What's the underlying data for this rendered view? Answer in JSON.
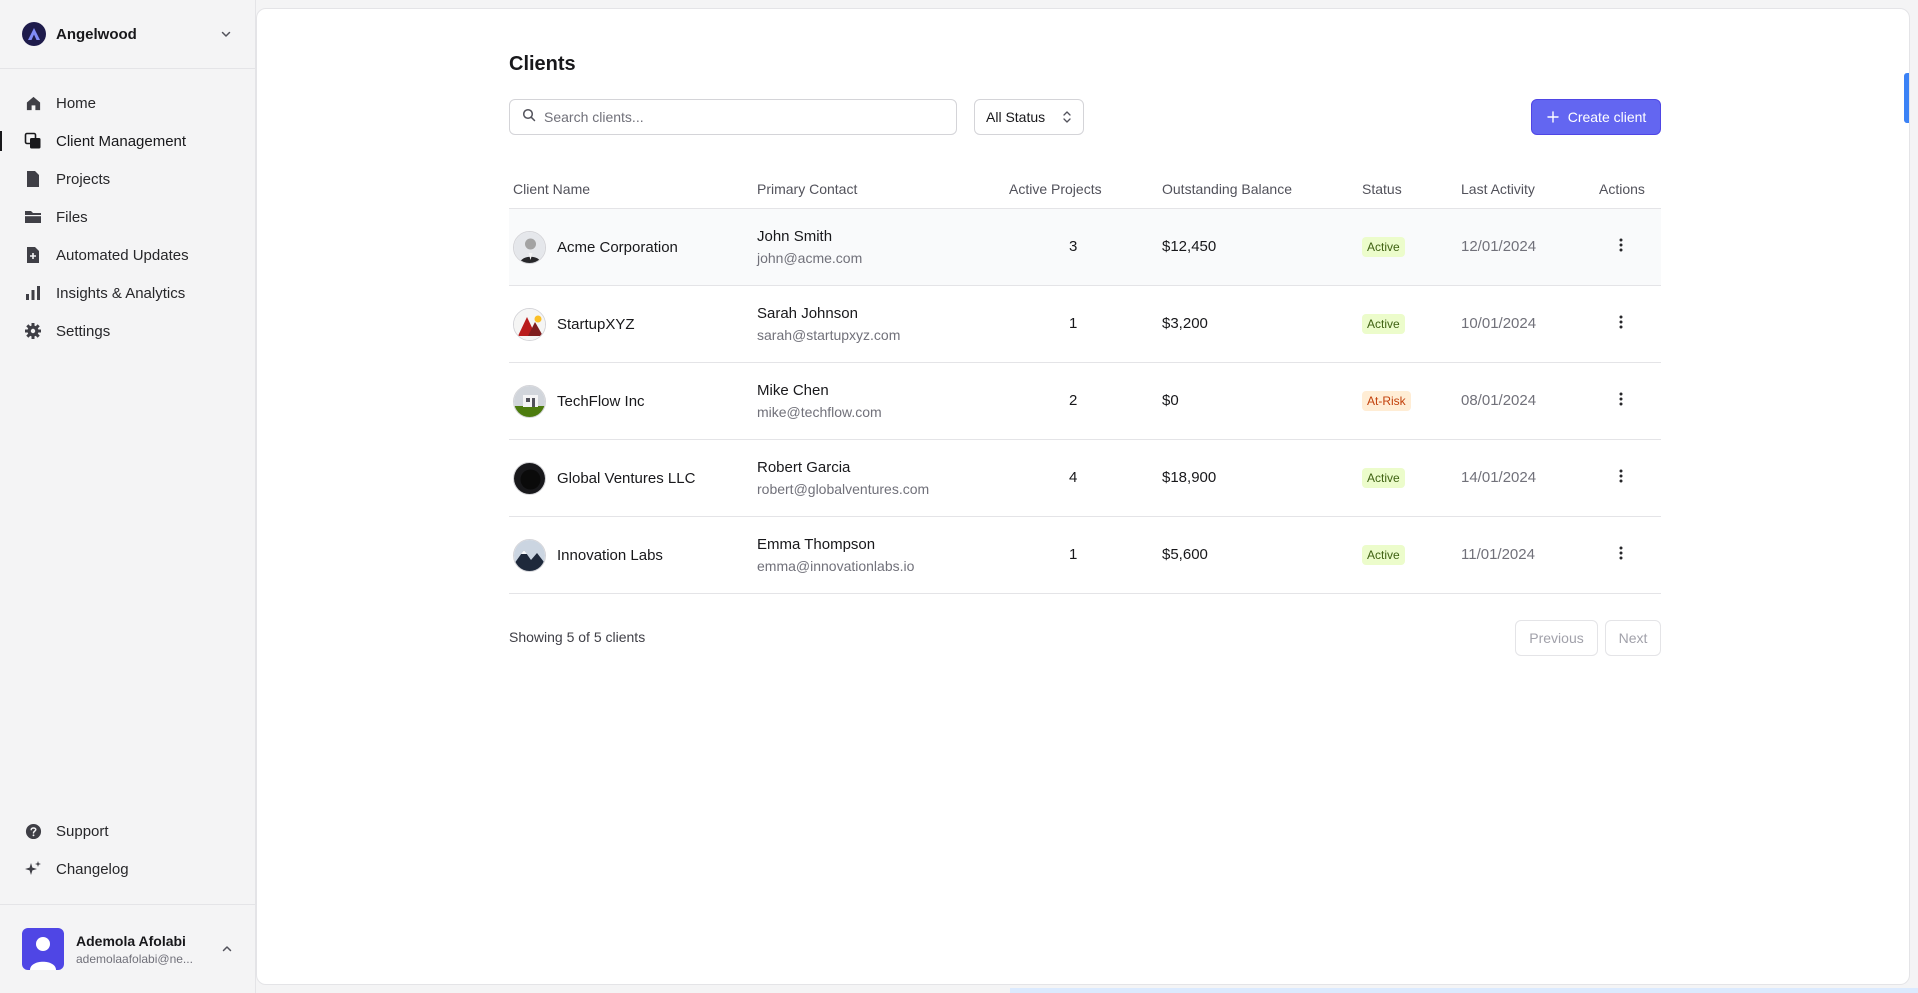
{
  "workspace": {
    "name": "Angelwood"
  },
  "nav": {
    "items": [
      {
        "label": "Home",
        "icon": "home-icon"
      },
      {
        "label": "Client Management",
        "icon": "stack-icon",
        "active": true
      },
      {
        "label": "Projects",
        "icon": "document-icon"
      },
      {
        "label": "Files",
        "icon": "folder-icon"
      },
      {
        "label": "Automated Updates",
        "icon": "file-plus-icon"
      },
      {
        "label": "Insights & Analytics",
        "icon": "bar-chart-icon"
      },
      {
        "label": "Settings",
        "icon": "gear-icon"
      }
    ],
    "bottom": [
      {
        "label": "Support",
        "icon": "help-circle-icon"
      },
      {
        "label": "Changelog",
        "icon": "sparkles-icon"
      }
    ]
  },
  "user": {
    "name": "Ademola Afolabi",
    "email": "ademolaafolabi@ne..."
  },
  "page": {
    "title": "Clients",
    "search_placeholder": "Search clients...",
    "status_filter": "All Status",
    "create_label": "Create client"
  },
  "table": {
    "headers": {
      "client": "Client Name",
      "contact": "Primary Contact",
      "projects": "Active Projects",
      "balance": "Outstanding Balance",
      "status": "Status",
      "activity": "Last Activity",
      "actions": "Actions"
    },
    "rows": [
      {
        "client": "Acme Corporation",
        "contact_name": "John Smith",
        "contact_email": "john@acme.com",
        "projects": "3",
        "balance": "$12,450",
        "status": "Active",
        "activity": "12/01/2024"
      },
      {
        "client": "StartupXYZ",
        "contact_name": "Sarah Johnson",
        "contact_email": "sarah@startupxyz.com",
        "projects": "1",
        "balance": "$3,200",
        "status": "Active",
        "activity": "10/01/2024"
      },
      {
        "client": "TechFlow Inc",
        "contact_name": "Mike Chen",
        "contact_email": "mike@techflow.com",
        "projects": "2",
        "balance": "$0",
        "status": "At-Risk",
        "activity": "08/01/2024"
      },
      {
        "client": "Global Ventures LLC",
        "contact_name": "Robert Garcia",
        "contact_email": "robert@globalventures.com",
        "projects": "4",
        "balance": "$18,900",
        "status": "Active",
        "activity": "14/01/2024"
      },
      {
        "client": "Innovation Labs",
        "contact_name": "Emma Thompson",
        "contact_email": "emma@innovationlabs.io",
        "projects": "1",
        "balance": "$5,600",
        "status": "Active",
        "activity": "11/01/2024"
      }
    ]
  },
  "pagination": {
    "summary": "Showing 5 of 5 clients",
    "previous": "Previous",
    "next": "Next"
  },
  "colors": {
    "accent": "#6366f1",
    "active_badge_bg": "#ecfccb",
    "active_badge_text": "#3f6212",
    "risk_badge_bg": "#ffedd5",
    "risk_badge_text": "#c2410c"
  }
}
